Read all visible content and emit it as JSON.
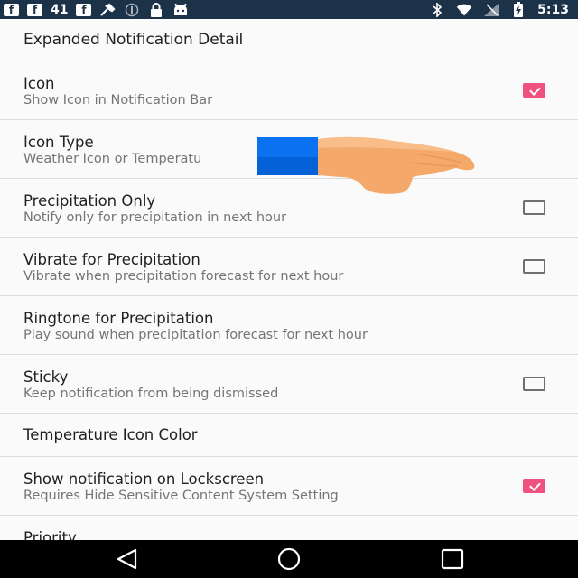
{
  "status_bar": {
    "notification_icons": [
      "facebook-icon",
      "facebook-icon",
      "facebook-icon",
      "tool-icon",
      "disabled-icon",
      "lock-icon",
      "android-icon"
    ],
    "facebook_glyph": "f",
    "number_badge": "41",
    "system_icons": [
      "bluetooth-icon",
      "wifi-icon",
      "no-signal-icon",
      "battery-charging-icon"
    ],
    "time": "5:13",
    "background_color": "#1c3248"
  },
  "settings": {
    "header": "Expanded Notification Detail",
    "items": [
      {
        "title": "Icon",
        "summary": "Show Icon in Notification Bar",
        "checkbox": true,
        "checked": true
      },
      {
        "title": "Icon Type",
        "summary": "Weather Icon or Temperatu",
        "checkbox": false
      },
      {
        "title": "Precipitation Only",
        "summary": "Notify only for precipitation in next hour",
        "checkbox": true,
        "checked": false
      },
      {
        "title": "Vibrate for Precipitation",
        "summary": "Vibrate when precipitation forecast for next hour",
        "checkbox": true,
        "checked": false
      },
      {
        "title": "Ringtone for Precipitation",
        "summary": "Play sound when precipitation forecast for next hour",
        "checkbox": false
      },
      {
        "title": "Sticky",
        "summary": "Keep notification from being dismissed",
        "checkbox": true,
        "checked": false
      },
      {
        "title": "Temperature Icon Color"
      },
      {
        "title": "Show notification on Lockscreen",
        "summary": "Requires Hide Sensitive Content System Setting",
        "checkbox": true,
        "checked": true
      },
      {
        "title": "Priority"
      }
    ],
    "accent_color": "#f0527f"
  },
  "overlay": {
    "cursor": "pointing-hand-icon",
    "marker_color": "#0a72f0"
  },
  "nav_bar": {
    "buttons": [
      "back-icon",
      "home-icon",
      "recents-icon"
    ]
  }
}
